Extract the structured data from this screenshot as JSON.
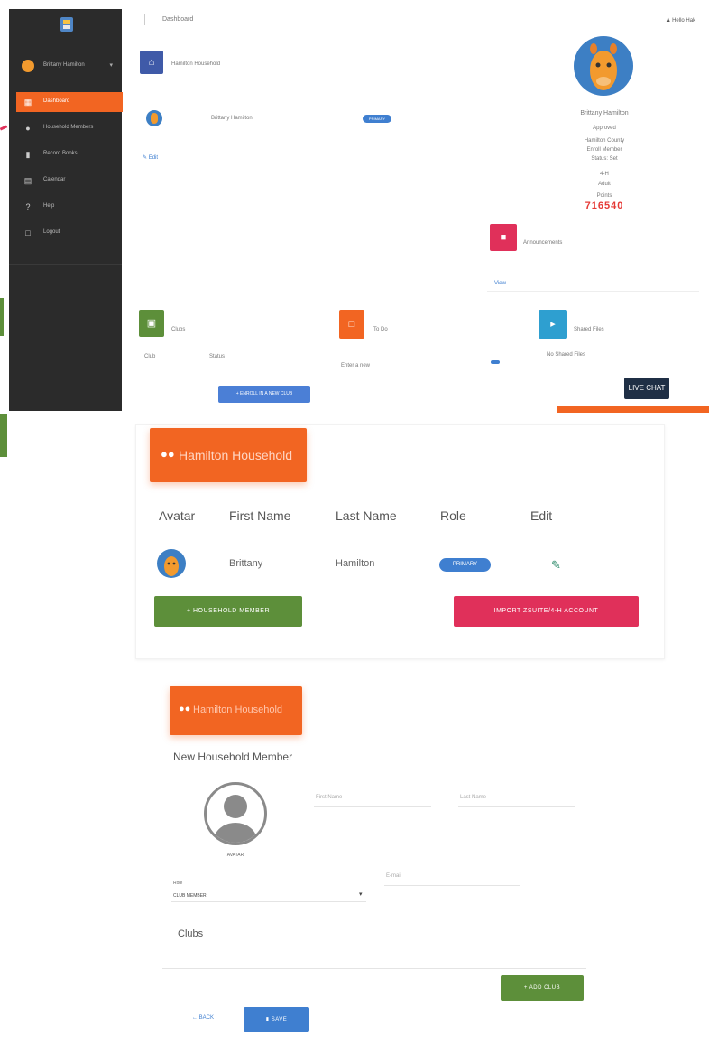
{
  "sidebar": {
    "user_name": "Brittany Hamilton",
    "items": [
      {
        "label": "Dashboard",
        "icon": "grid-icon",
        "active": true
      },
      {
        "label": "Household Members",
        "icon": "users-icon",
        "active": false
      },
      {
        "label": "Record Books",
        "icon": "book-icon",
        "active": false
      },
      {
        "label": "Calendar",
        "icon": "calendar-icon",
        "active": false
      },
      {
        "label": "Help",
        "icon": "help-icon",
        "active": false
      },
      {
        "label": "Logout",
        "icon": "logout-icon",
        "active": false
      }
    ]
  },
  "header": {
    "breadcrumb": "Dashboard",
    "account_label": "Hello Hak"
  },
  "dashboard": {
    "household_card_title": "Hamilton Household",
    "member_name": "Brittany Hamilton",
    "role_badge": "PRIMARY",
    "edit_link": "Edit",
    "profile": {
      "name": "Brittany Hamilton",
      "status": "Approved",
      "county": "Hamilton County",
      "email_line": "Enroll Member",
      "phone_line": "Status: Set",
      "role_label": "4-H",
      "grade_label": "Adult",
      "points_label": "Points",
      "points": "716540"
    },
    "announcements_title": "Announcements",
    "announcements_link": "View",
    "clubs_title": "Clubs",
    "clubs_col_club": "Club",
    "clubs_col_status": "Status",
    "todo_title": "To Do",
    "todo_text": "Enter a new",
    "shared_title": "Shared Files",
    "shared_text": "No Shared Files",
    "enroll_button": "+ ENROLL IN A NEW CLUB",
    "live_chat": "LIVE CHAT"
  },
  "household": {
    "title": "Hamilton Household",
    "columns": [
      "Avatar",
      "First Name",
      "Last Name",
      "Role",
      "Edit"
    ],
    "rows": [
      {
        "first": "Brittany",
        "last": "Hamilton",
        "role": "PRIMARY"
      }
    ],
    "add_member_button": "+ HOUSEHOLD MEMBER",
    "import_button": "IMPORT ZSUITE/4-H ACCOUNT"
  },
  "new_member": {
    "title": "Hamilton Household",
    "heading": "New Household Member",
    "avatar_label": "AVATAR",
    "first_name_placeholder": "First Name",
    "last_name_placeholder": "Last Name",
    "role_label": "Role",
    "role_value": "CLUB MEMBER",
    "email_placeholder": "E-mail",
    "clubs_heading": "Clubs",
    "add_club_button": "+ ADD CLUB",
    "back_button": "BACK",
    "save_button": "SAVE"
  },
  "colors": {
    "sidebar_bg": "#2b2b2b",
    "accent_orange": "#f26522",
    "blue": "#3f5aa8",
    "pink": "#e0305a",
    "green": "#5d8f3a",
    "teal": "#2e9fd0",
    "points_red": "#e53935"
  }
}
